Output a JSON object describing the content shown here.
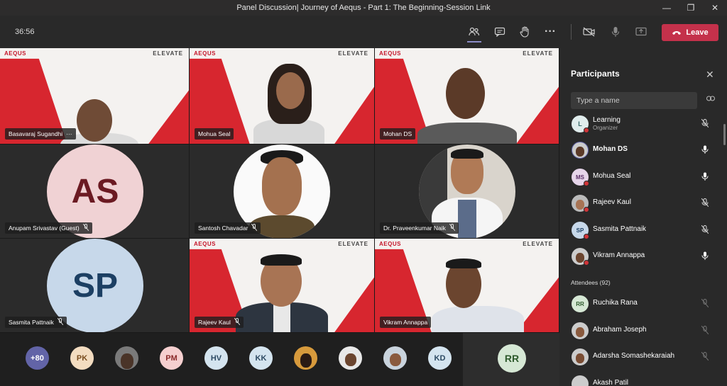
{
  "window": {
    "title": "Panel Discussion| Journey of Aequs - Part 1: The Beginning-Session Link",
    "controls": [
      "—",
      "❐",
      "✕"
    ]
  },
  "toolbar": {
    "timer": "36:56",
    "leave_label": "Leave"
  },
  "tiles": [
    {
      "name": "Basavaraj Sugandhi",
      "extra": "···",
      "brand_left": "AEQUS",
      "brand_right": "ELEVATE"
    },
    {
      "name": "Mohua Seal",
      "brand_left": "AEQUS",
      "brand_right": "ELEVATE"
    },
    {
      "name": "Mohan DS",
      "brand_left": "AEQUS",
      "brand_right": "ELEVATE"
    },
    {
      "name": "Anupam Srivastav (Guest)",
      "initials": "AS"
    },
    {
      "name": "Santosh Chavadar"
    },
    {
      "name": "Dr. Praveenkumar Naik"
    },
    {
      "name": "Sasmita Pattnaik",
      "initials": "SP"
    },
    {
      "name": "Rajeev Kaul",
      "brand_left": "AEQUS",
      "brand_right": "ELEVATE"
    },
    {
      "name": "Vikram Annappa",
      "brand_left": "AEQUS",
      "brand_right": "ELEVATE"
    }
  ],
  "strip": {
    "items": [
      "+80",
      "PK",
      "",
      "PM",
      "HV",
      "KK",
      "",
      "",
      "",
      "KD"
    ],
    "active": "RR"
  },
  "panel": {
    "title": "Participants",
    "search_placeholder": "Type a name",
    "participants": [
      {
        "name": "Learning",
        "sub": "Organizer",
        "initials": "L",
        "mic": "muted"
      },
      {
        "name": "Mohan DS",
        "initials": "",
        "mic": "on",
        "bold": true
      },
      {
        "name": "Mohua Seal",
        "initials": "MS",
        "mic": "on"
      },
      {
        "name": "Rajeev Kaul",
        "initials": "",
        "mic": "muted"
      },
      {
        "name": "Sasmita Pattnaik",
        "initials": "SP",
        "mic": "muted"
      },
      {
        "name": "Vikram Annappa",
        "initials": "",
        "mic": "on"
      }
    ],
    "attendees_label": "Attendees (92)",
    "attendees": [
      {
        "name": "Ruchika Rana",
        "initials": "RR"
      },
      {
        "name": "Abraham Joseph",
        "initials": ""
      },
      {
        "name": "Adarsha Somashekaraiah",
        "initials": ""
      },
      {
        "name": "Akash Patil",
        "initials": ""
      }
    ]
  },
  "colors": {
    "accent": "#c4314b",
    "brand_red": "#d7262f",
    "muted_dot": "#d13438"
  }
}
